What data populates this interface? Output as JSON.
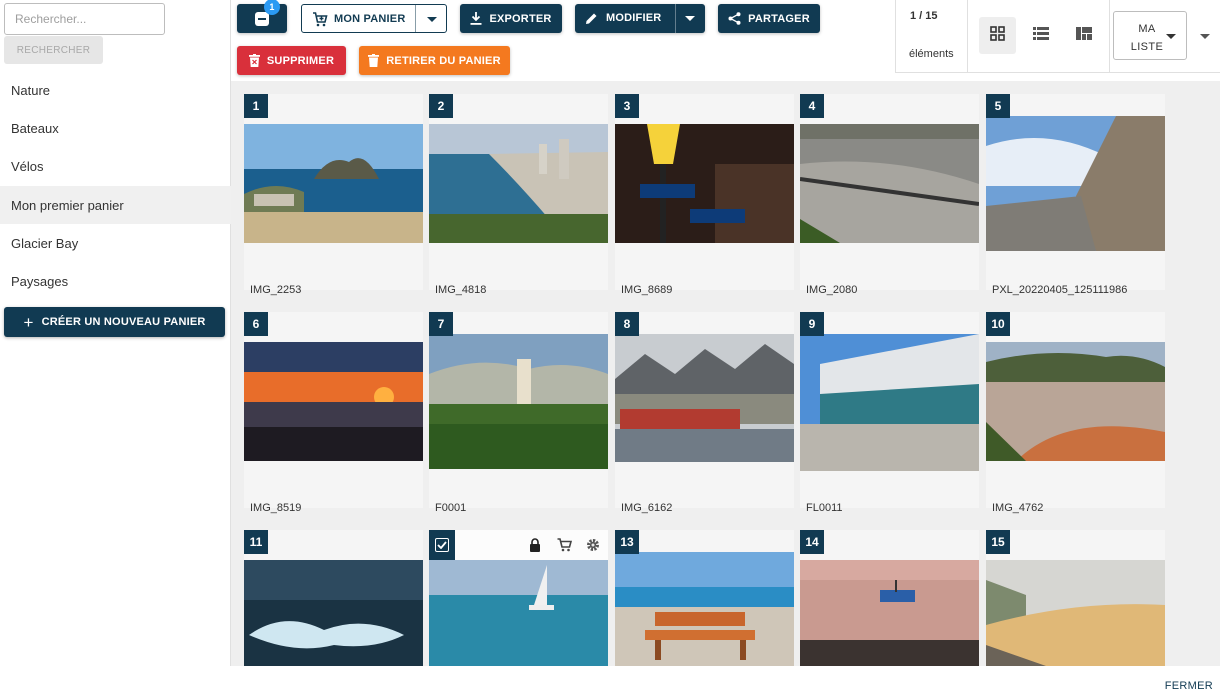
{
  "sidebar": {
    "search_placeholder": "Rechercher...",
    "search_button": "RECHERCHER",
    "baskets": [
      {
        "label": "Nature",
        "active": false
      },
      {
        "label": "Bateaux",
        "active": false
      },
      {
        "label": "Vélos",
        "active": false
      },
      {
        "label": "Mon premier panier",
        "active": true
      },
      {
        "label": "Glacier Bay",
        "active": false
      },
      {
        "label": "Paysages",
        "active": false
      }
    ],
    "new_basket_button": "CRÉER UN NOUVEAU PANIER"
  },
  "toolbar": {
    "basket_badge": "1",
    "my_basket": "MON PANIER",
    "export": "EXPORTER",
    "modify": "MODIFIER",
    "share": "PARTAGER",
    "delete": "SUPPRIMER",
    "remove_from_basket": "RETIRER DU PANIER",
    "count": "1 / 15",
    "count_label": "éléments",
    "list_select": "MA LISTE",
    "colors": {
      "dark": "#113a52",
      "red": "#d9303b",
      "orange": "#f4791f",
      "badge": "#2b9af3"
    }
  },
  "items": [
    {
      "num": "1",
      "name": "IMG_2253"
    },
    {
      "num": "2",
      "name": "IMG_4818"
    },
    {
      "num": "3",
      "name": "IMG_8689"
    },
    {
      "num": "4",
      "name": "IMG_2080"
    },
    {
      "num": "5",
      "name": "PXL_20220405_125111986"
    },
    {
      "num": "6",
      "name": "IMG_8519"
    },
    {
      "num": "7",
      "name": "F0001"
    },
    {
      "num": "8",
      "name": "IMG_6162"
    },
    {
      "num": "9",
      "name": "FL0011"
    },
    {
      "num": "10",
      "name": "IMG_4762"
    },
    {
      "num": "11",
      "name": ""
    },
    {
      "num": "12",
      "name": "",
      "selected": true
    },
    {
      "num": "13",
      "name": ""
    },
    {
      "num": "14",
      "name": ""
    },
    {
      "num": "15",
      "name": ""
    }
  ],
  "footer": {
    "close": "FERMER"
  }
}
